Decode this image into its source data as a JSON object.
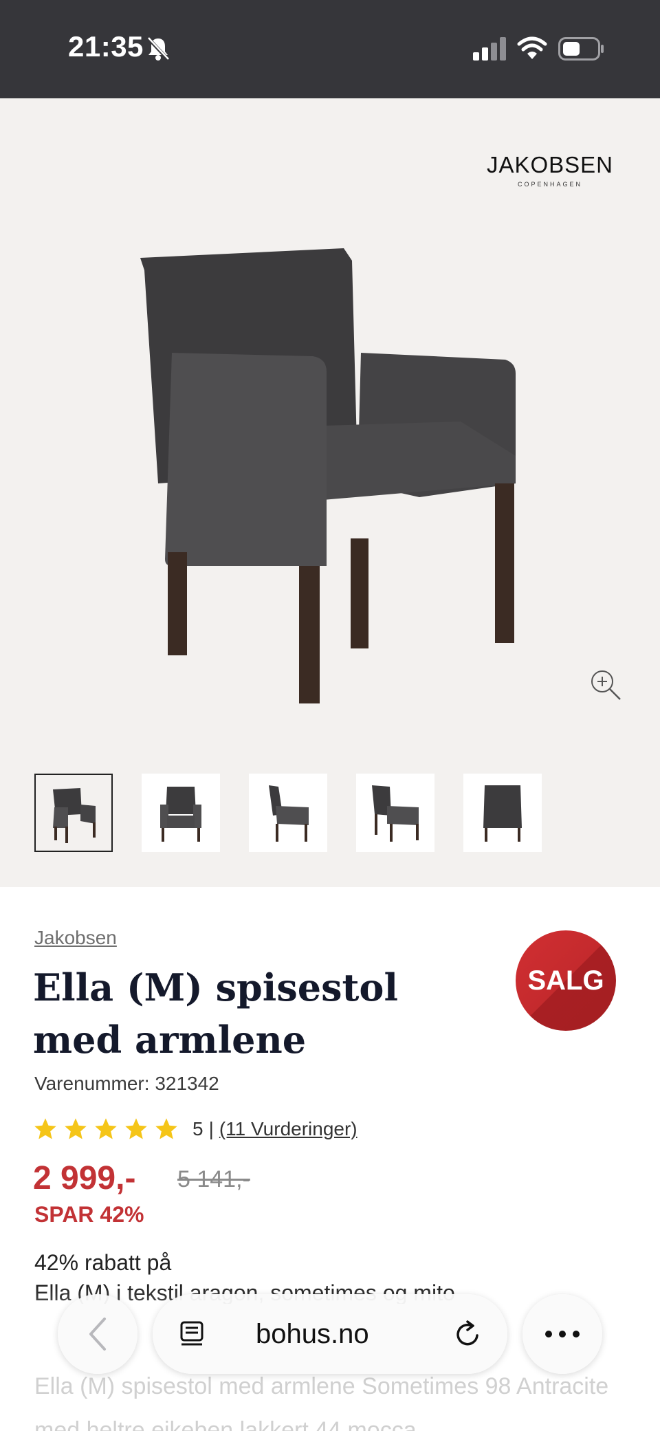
{
  "status_bar": {
    "time": "21:35"
  },
  "gallery": {
    "brand_logo": "JAKOBSEN",
    "brand_logo_sub": "COPENHAGEN",
    "thumbnails": [
      "front-left",
      "front",
      "side",
      "back-left",
      "back"
    ]
  },
  "product": {
    "brand": "Jakobsen",
    "title": "Ella (M) spisestol med armlene",
    "sale_badge": "SALG",
    "sku": "Varenummer: 321342",
    "rating_value": "5",
    "rating_separator": "|",
    "reviews": "(11 Vurderinger)",
    "stars": 5,
    "price_now": "2 999,-",
    "price_old": "5 141,-",
    "save": "SPAR 42%",
    "discount_title": "42% rabatt på",
    "discount_text": "Ella (M) i tekstil aragon, sometimes og mito",
    "description": "Ella (M) spisestol med armlene Sometimes 98 Antracite med heltre eikeben lakkert 44 mocca"
  },
  "browser": {
    "url": "bohus.no"
  },
  "colors": {
    "sale_red": "#c23235",
    "star_yellow": "#f5c518",
    "status_bar_bg": "#36363a",
    "gallery_bg": "#f3f1ef"
  }
}
